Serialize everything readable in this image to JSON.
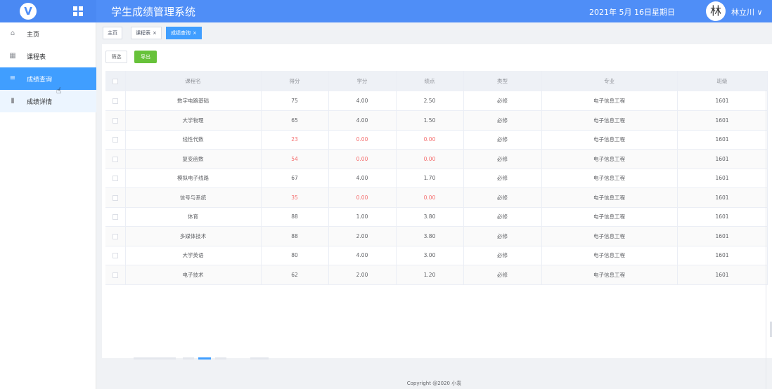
{
  "header": {
    "app_title": "学生成绩管理系统",
    "date": "2021年 5月 16日",
    "weekday": "星期日",
    "avatar_char": "林",
    "user_name": "林立川 ∨",
    "logo_icon": "v-logo-icon",
    "bg_color": "#4f8ef7"
  },
  "sidebar": {
    "items": [
      {
        "label": "主页",
        "icon": "home-icon"
      },
      {
        "label": "课程表",
        "icon": "table-icon"
      },
      {
        "label": "成绩查询",
        "icon": "list-icon"
      },
      {
        "label": "成绩详情",
        "icon": "bar-chart-icon"
      }
    ],
    "active_color": "#409eff"
  },
  "tabs": [
    {
      "label": "主页",
      "close": ""
    },
    {
      "label": "课程表",
      "close": "×"
    },
    {
      "label": "成绩查询",
      "close": "×"
    }
  ],
  "toolbar": {
    "filter_label": "筛选",
    "export_label": "导出"
  },
  "table": {
    "headers": [
      "课程名",
      "得分",
      "学分",
      "绩点",
      "类型",
      "专业",
      "班级"
    ],
    "rows": [
      [
        "数字电路基础",
        "75",
        "4.00",
        "2.50",
        "必修",
        "电子信息工程",
        "1601"
      ],
      [
        "大学物理",
        "65",
        "4.00",
        "1.50",
        "必修",
        "电子信息工程",
        "1601"
      ],
      [
        "线性代数",
        "23",
        "0.00",
        "0.00",
        "必修",
        "电子信息工程",
        "1601"
      ],
      [
        "复变函数",
        "54",
        "0.00",
        "0.00",
        "必修",
        "电子信息工程",
        "1601"
      ],
      [
        "模拟电子线路",
        "67",
        "4.00",
        "1.70",
        "必修",
        "电子信息工程",
        "1601"
      ],
      [
        "信号与系统",
        "35",
        "0.00",
        "0.00",
        "必修",
        "电子信息工程",
        "1601"
      ],
      [
        "体育",
        "88",
        "1.00",
        "3.80",
        "必修",
        "电子信息工程",
        "1601"
      ],
      [
        "多媒体技术",
        "88",
        "2.00",
        "3.80",
        "必修",
        "电子信息工程",
        "1601"
      ],
      [
        "大学英语",
        "80",
        "4.00",
        "3.00",
        "必修",
        "电子信息工程",
        "1601"
      ],
      [
        "电子技术",
        "62",
        "2.00",
        "1.20",
        "必修",
        "电子信息工程",
        "1601"
      ]
    ],
    "fail_color": "#f56c6c"
  },
  "footer": {
    "copyright": "Copyright @2020 小袁"
  }
}
